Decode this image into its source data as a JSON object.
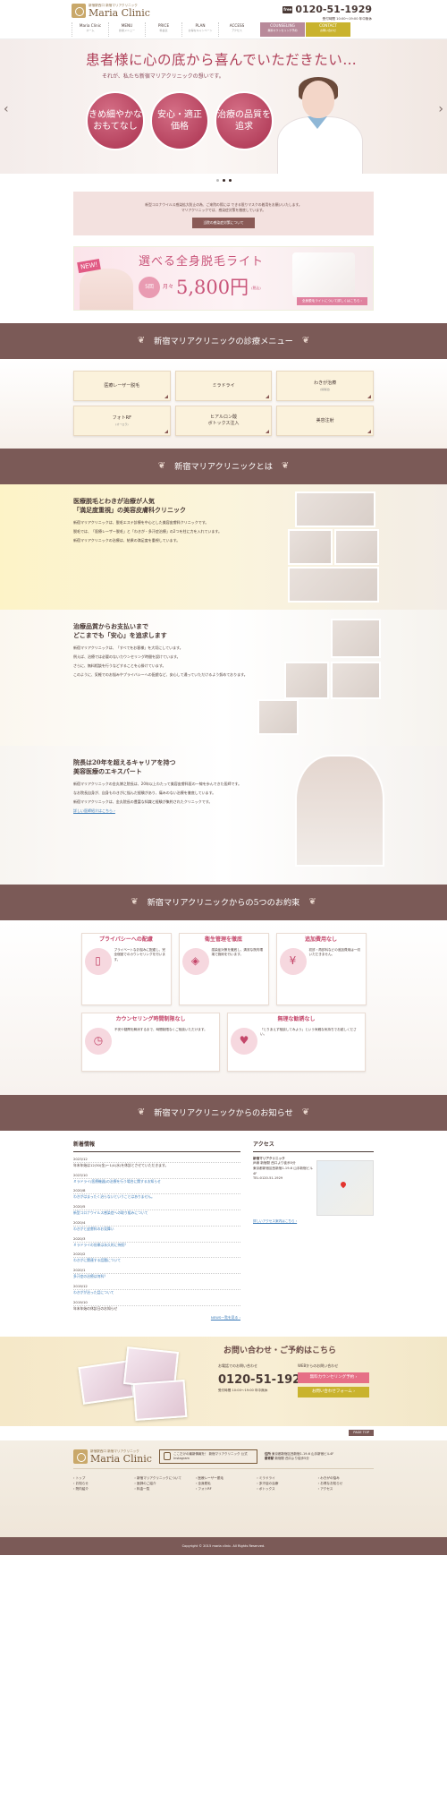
{
  "header": {
    "logo_sub": "新宿駅西口  新宿マリアクリニック",
    "logo_main": "Maria Clinic",
    "tel_icon": "free",
    "tel": "0120-51-1929",
    "hours": "受付時間 10:00～19:00 年中無休",
    "nav": [
      {
        "label": "Maria Clinic",
        "sub": "ホーム"
      },
      {
        "label": "MENU",
        "sub": "診療メニュー"
      },
      {
        "label": "PRICE",
        "sub": "料金表"
      },
      {
        "label": "PLAN",
        "sub": "お得なキャンペーン"
      },
      {
        "label": "ACCESS",
        "sub": "アクセス"
      }
    ],
    "btn_counsel": "COUNSELING",
    "btn_counsel_sub": "無料カウンセリング予約",
    "btn_contact": "CONTACT",
    "btn_contact_sub": "お問い合わせ"
  },
  "hero": {
    "title": "患者様に心の底から喜んでいただきたい…",
    "subtitle": "それが、私たち新宿マリアクリニックの想いです。",
    "circles": [
      "きめ細やかな\nおもてなし",
      "安心・適正\n価格",
      "治療の品質を\n追求"
    ],
    "prev": "‹",
    "next": "›"
  },
  "notice": {
    "text1": "新型コロナウイルス感染拡大防止の為、ご来院の際には できる限りマスクの着用をお願いいたします。",
    "text2": "マリアクリニックでは、感染症対策を徹底しています。",
    "button": "当院の感染症対策について"
  },
  "banner": {
    "new": "NEW!",
    "title": "選べる全身脱毛ライト",
    "count": "5回",
    "month": "月々",
    "price": "5,800円",
    "tax": "(税込)",
    "more": "全身脱毛ライトについて詳しくはこちら ›"
  },
  "sections": {
    "menu_title": "新宿マリアクリニックの診療メニュー",
    "about_title": "新宿マリアクリニックとは",
    "promise_title": "新宿マリアクリニックからの5つのお約束",
    "news_title": "新宿マリアクリニックからのお知らせ"
  },
  "menu": [
    {
      "label": "医療レーザー脱毛",
      "sub": ""
    },
    {
      "label": "ミラドライ",
      "sub": ""
    },
    {
      "label": "わきが治療",
      "sub": "(剪除法)"
    },
    {
      "label": "フォトRF",
      "sub": "(オーロラ)"
    },
    {
      "label": "ヒアルロン酸\nボトックス注入",
      "sub": ""
    },
    {
      "label": "美容注射",
      "sub": ""
    }
  ],
  "about": [
    {
      "heading": "医療脱毛とわきが治療が人気\n「満足度重視」の美容皮膚科クリニック",
      "paras": [
        "新宿マリアクリニックは、脱毛エステ診療を中心とした美容皮膚科クリニックです。",
        "脱毛では、「医療レーザー脱毛」と「わきが・多汗症治療」の2つを柱に力を入れています。",
        "新宿マリアクリニックの治療は、結果の満足度を重視しています。"
      ]
    },
    {
      "heading": "治療品質からお支払いまで\nどこまでも「安心」を追求します",
      "paras": [
        "新宿マリアクリニックは、「すべてをお客様」を大切にしています。",
        "例えば、治療では必要のないカウンセリング時間を設けています。",
        "さらに、無料相談を行うなどすることを心掛けています。",
        "このように、気軽でのお悩みやプライバシーへの配慮など、安心して通っていただけるよう努めております。"
      ]
    },
    {
      "heading": "院長は20年を超えるキャリアを持つ\n美容医療のエキスパート",
      "paras": [
        "新宿マリアクリニックの金丸博之院長は、20年以上わたって美容皮膚科医の一線を歩んできた医師です。",
        "なお院長自身が、自身もわきがに悩んだ経験があり、痛みのない治療を徹底しています。",
        "新宿マリアクリニックは、金丸院長の豊富な知識と経験が集約されたクリニックです。"
      ],
      "link": "詳しい医師紹介はこちら ›"
    }
  ],
  "promises": [
    {
      "title": "プライバシーへの配慮",
      "icon": "door-icon",
      "text": "プライベートなお悩みに配慮し、完全個室でのカウンセリングを行います。"
    },
    {
      "title": "衛生管理を徹底",
      "icon": "layers-icon",
      "text": "感染症対策を徹底し、清潔な院内環境で施術を行います。"
    },
    {
      "title": "追加費用なし",
      "icon": "yen-icon",
      "text": "初診・再診料などの追加費用は一切いただきません。"
    },
    {
      "title": "カウンセリング時間制限なし",
      "icon": "clock-icon",
      "text": "不安や疑問を解消するまで、時間制限なくご相談いただけます。"
    },
    {
      "title": "無理な勧誘なし",
      "icon": "heart-icon",
      "text": "「とりあえず相談してみよう」という気軽な気持ちでお越しください。"
    }
  ],
  "news": {
    "heading": "新着情報",
    "items": [
      {
        "date": "2023/12",
        "text": "年末年始は12/30(金)～1/4(水)を休診とさせていただきます。"
      },
      {
        "date": "2023/10",
        "text": "ミラドライ(医療機器)の治療を行う場合に関するお知らせ"
      },
      {
        "date": "2020/8",
        "text": "わきがはまったく治らないということはありません。"
      },
      {
        "date": "2020/5",
        "text": "新型コロナウイルス感染症への取り組みについて"
      },
      {
        "date": "2020/4",
        "text": "わきがと皮膚科のお見舞い"
      },
      {
        "date": "2020/3",
        "text": "ミラドライの効果は永久的に持続？"
      },
      {
        "date": "2020/2",
        "text": "わきがに関連する話題について"
      },
      {
        "date": "2020/1",
        "text": "多汗症の治療は何科？"
      },
      {
        "date": "2019/12",
        "text": "わきがが治った話について"
      },
      {
        "date": "2019/10",
        "text": "年末年始の休診日のお知らせ"
      }
    ],
    "more": "NEWS一覧を見る ›"
  },
  "access": {
    "heading": "アクセス",
    "name": "新宿マリアクリニック",
    "address": "JR線 新宿駅 西口より徒歩5分\n東京都新宿区西新宿1-19-6 山手新宿ビル4F",
    "tel": "TEL:0120-51-1929",
    "link": "詳しいアクセス案内はこちら ›"
  },
  "cta": {
    "title": "お問い合わせ・ご予約はこちら",
    "label_tel": "お電話でのお問い合わせ",
    "label_web": "WEBからのお問い合わせ",
    "tel": "0120-51-1929",
    "hours": "受付時間 10:00～19:00 年中無休",
    "btn1": "無料カウンセリング予約 ›",
    "btn2": "お問い合わせフォーム ›"
  },
  "pagetop": "PAGE TOP",
  "footer": {
    "instagram": "ここだけの最新情報を！ 新宿マリアクリニック 公式Instagram",
    "addr_label": "住所",
    "address": "東京都新宿区西新宿1-19-6 山手新宿ビル4F",
    "access_label": "最寄駅",
    "access": "新宿駅 西口より徒歩5分",
    "links": [
      "トップ",
      "新宿マリアクリニックについて",
      "医療レーザー脱毛",
      "ミラドライ",
      "わきがの悩み",
      "お知らせ",
      "医師のご紹介",
      "全身脱毛",
      "多汗症の治療",
      "お得なお知らせ",
      "院内紹介",
      "料金一覧",
      "フォトRF",
      "ボトックス",
      "アクセス"
    ],
    "copyright": "Copyright © 2015 maria clinic. All Rights Reserved."
  }
}
